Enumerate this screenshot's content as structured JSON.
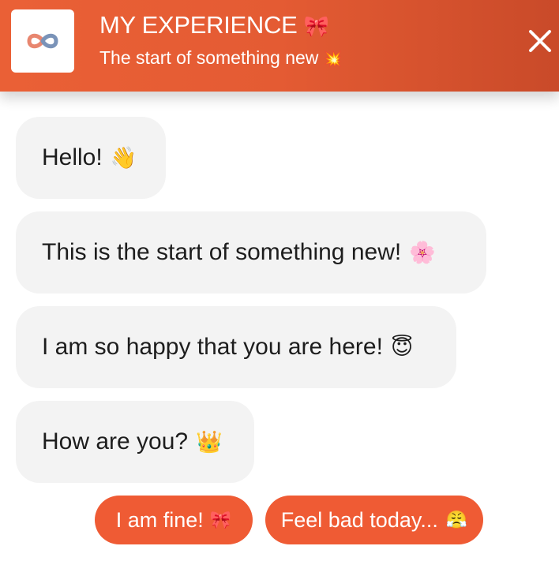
{
  "header": {
    "title": "MY EXPERIENCE",
    "title_emoji": "🎀",
    "subtitle": "The start of something new",
    "subtitle_emoji": "💥",
    "logo_icon": "infinity-logo-icon",
    "close_icon": "close-icon"
  },
  "messages": [
    {
      "text": "Hello!",
      "emoji": "👋"
    },
    {
      "text": "This is the start of something new!",
      "emoji": "🌸"
    },
    {
      "text": "I am so happy that you are here!",
      "emoji": "😇"
    },
    {
      "text": "How are you?",
      "emoji": "👑"
    }
  ],
  "quick_replies": [
    {
      "label": "I am fine!",
      "emoji": "🎀"
    },
    {
      "label": "Feel bad today...",
      "emoji": "😤"
    }
  ],
  "colors": {
    "brand": "#e45b33",
    "button": "#ef5b34",
    "bubble_bg": "#f3f3f3"
  }
}
